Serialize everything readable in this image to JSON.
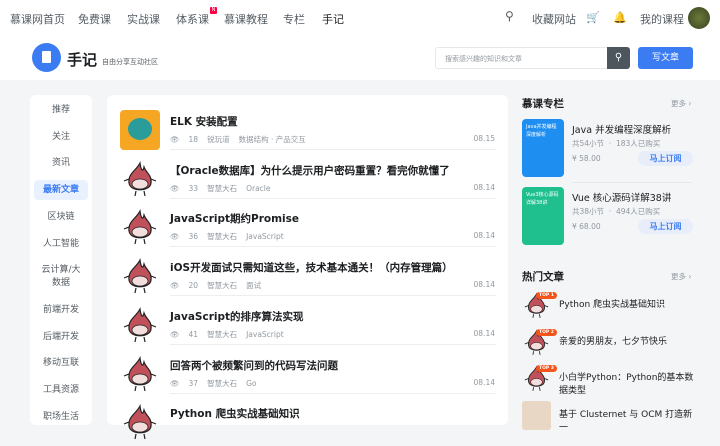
{
  "topnav": {
    "items": [
      "慕课网首页",
      "免费课",
      "实战课",
      "体系课",
      "慕课教程",
      "专栏",
      "手记"
    ],
    "new_badge": "N",
    "collect": "收藏网站",
    "my_courses": "我的课程"
  },
  "header": {
    "title": "手记",
    "subtitle": "自由分享互动社区",
    "search_placeholder": "搜索感兴趣的知识和文章",
    "write_label": "写文章"
  },
  "sidebar": {
    "items": [
      "推荐",
      "关注",
      "资讯",
      "最新文章",
      "区块链",
      "人工智能",
      "云计算/大数据",
      "前端开发",
      "后端开发",
      "移动互联",
      "工具资源",
      "职场生活"
    ],
    "active": "最新文章"
  },
  "articles": [
    {
      "title": "ELK 安装配置",
      "views": "18",
      "author": "锐玩道",
      "tags": "数据结构 · 产品交互",
      "date": "08.15"
    },
    {
      "title": "【Oracle数据库】为什么提示用户密码重置？看完你就懂了",
      "views": "33",
      "author": "智慧大石",
      "tags": "Oracle",
      "date": "08.14"
    },
    {
      "title": "JavaScript期约Promise",
      "views": "36",
      "author": "智慧大石",
      "tags": "JavaScript",
      "date": "08.14"
    },
    {
      "title": "iOS开发面试只需知道这些，技术基本通关！（内存管理篇）",
      "views": "20",
      "author": "智慧大石",
      "tags": "面试",
      "date": "08.14"
    },
    {
      "title": "JavaScript的排序算法实现",
      "views": "41",
      "author": "智慧大石",
      "tags": "JavaScript",
      "date": "08.14"
    },
    {
      "title": "回答两个被频繁问到的代码写法问题",
      "views": "37",
      "author": "智慧大石",
      "tags": "Go",
      "date": "08.14"
    },
    {
      "title": "Python 爬虫实战基础知识",
      "views": "",
      "author": "",
      "tags": "",
      "date": ""
    }
  ],
  "columns": {
    "heading": "慕课专栏",
    "more": "更多 ›",
    "items": [
      {
        "cover": "Java并发编程深度解析",
        "title": "Java 并发编程深度解析",
        "sections": "共54小节",
        "buyers": "183人已购买",
        "price": "¥ 58.00",
        "subscribe": "马上订阅",
        "color": "#1f8ef1"
      },
      {
        "cover": "Vue3核心源码详解38讲",
        "title": "Vue 核心源码详解38讲",
        "sections": "共38小节",
        "buyers": "494人已购买",
        "price": "¥ 68.00",
        "subscribe": "马上订阅",
        "color": "#1fc08e"
      }
    ]
  },
  "hot": {
    "heading": "热门文章",
    "more": "更多 ›",
    "items": [
      {
        "tag": "TOP 1",
        "title": "Python 爬虫实战基础知识"
      },
      {
        "tag": "TOP 2",
        "title": "亲爱的男朋友，七夕节快乐"
      },
      {
        "tag": "TOP 3",
        "title": "小白学Python：Python的基本数据类型"
      },
      {
        "tag": "",
        "title": "基于 Clusternet 与 OCM 打造新一"
      }
    ]
  }
}
